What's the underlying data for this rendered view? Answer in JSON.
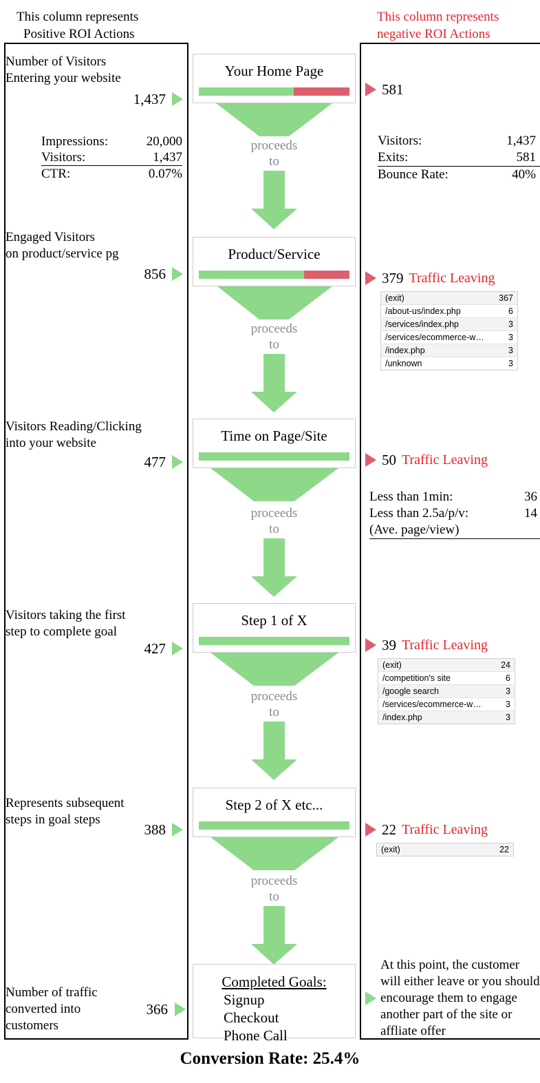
{
  "headers": {
    "left": "This column represents\nPositive ROI Actions",
    "right": "This column represents\nnegative ROI Actions",
    "left_line1": "This column represents",
    "left_line2": "Positive ROI Actions",
    "right_line1": "This column represents",
    "right_line2": "negative ROI Actions",
    "right_color": "#e8232a"
  },
  "colors": {
    "positive": "#8ed88a",
    "negative": "#dd5f6e",
    "proceeds_text": "#8a8a8a",
    "red_text": "#e8232a"
  },
  "proceeds_label_line1": "proceeds",
  "proceeds_label_line2": "to",
  "stages": [
    {
      "id": "home-page",
      "center_title": "Your Home Page",
      "bar_green_pct": 63,
      "bar_red_pct": 37,
      "left_desc_line1": "Number of Visitors",
      "left_desc_line2": "Entering your website",
      "left_value": "1,437",
      "left_stats": [
        {
          "label": "Impressions:",
          "value": "20,000",
          "underline": false
        },
        {
          "label": "Visitors:",
          "value": "1,437",
          "underline": true
        },
        {
          "label": "CTR:",
          "value": "0.07%",
          "underline": false
        }
      ],
      "right_value": "581",
      "right_label": "",
      "right_stats": [
        {
          "label": "Visitors:",
          "value": "1,437",
          "underline": false
        },
        {
          "label": "Exits:",
          "value": "581",
          "underline": true
        },
        {
          "label": "Bounce Rate:",
          "value": "40%",
          "underline": false
        }
      ],
      "exit_rows": []
    },
    {
      "id": "product-service",
      "center_title": "Product/Service",
      "bar_green_pct": 70,
      "bar_red_pct": 30,
      "left_desc_line1": "Engaged Visitors",
      "left_desc_line2": "on product/service pg",
      "left_value": "856",
      "right_value": "379",
      "right_label": "Traffic Leaving",
      "exit_rows": [
        {
          "page": "(exit)",
          "count": "367"
        },
        {
          "page": "/about-us/index.php",
          "count": "6"
        },
        {
          "page": "/services/index.php",
          "count": "3"
        },
        {
          "page": "/services/ecommerce-w…",
          "count": "3"
        },
        {
          "page": "/index.php",
          "count": "3"
        },
        {
          "page": "/unknown",
          "count": "3"
        }
      ]
    },
    {
      "id": "time-on-page",
      "center_title": "Time on Page/Site",
      "bar_green_pct": 100,
      "bar_red_pct": 0,
      "left_desc_line1": "Visitors Reading/Clicking",
      "left_desc_line2": "into your website",
      "left_value": "477",
      "right_value": "50",
      "right_label": "Traffic Leaving",
      "right_stats": [
        {
          "label": "Less than 1min:",
          "value": "36",
          "underline": false
        },
        {
          "label": "Less than 2.5a/p/v:",
          "value": "14",
          "underline": false
        },
        {
          "label": "(Ave. page/view)",
          "value": "",
          "underline": true
        }
      ],
      "exit_rows": []
    },
    {
      "id": "step-1",
      "center_title": "Step 1 of X",
      "bar_green_pct": 100,
      "bar_red_pct": 0,
      "left_desc_line1": "Visitors taking the first",
      "left_desc_line2": "step to complete goal",
      "left_value": "427",
      "right_value": "39",
      "right_label": "Traffic Leaving",
      "exit_rows": [
        {
          "page": "(exit)",
          "count": "24"
        },
        {
          "page": "/competition's site",
          "count": "6"
        },
        {
          "page": "/google search",
          "count": "3"
        },
        {
          "page": "/services/ecommerce-w…",
          "count": "3"
        },
        {
          "page": "/index.php",
          "count": "3"
        }
      ]
    },
    {
      "id": "step-2",
      "center_title": "Step 2 of X etc...",
      "bar_green_pct": 100,
      "bar_red_pct": 0,
      "left_desc_line1": "Represents subsequent",
      "left_desc_line2": "steps in goal steps",
      "left_value": "388",
      "right_value": "22",
      "right_label": "Traffic Leaving",
      "exit_rows": [
        {
          "page": "(exit)",
          "count": "22"
        }
      ]
    }
  ],
  "goals": {
    "heading": "Completed Goals:",
    "items": [
      "Signup",
      "Checkout",
      "Phone Call"
    ],
    "left_desc_line1": "Number of traffic",
    "left_desc_line2": "converted into",
    "left_desc_line3": "customers",
    "left_value": "366",
    "right_note": "At this point, the customer will either leave or you should encourage them to engage another part of the site or affliate offer"
  },
  "footer": {
    "conversion_rate": "Conversion Rate: 25.4%"
  }
}
